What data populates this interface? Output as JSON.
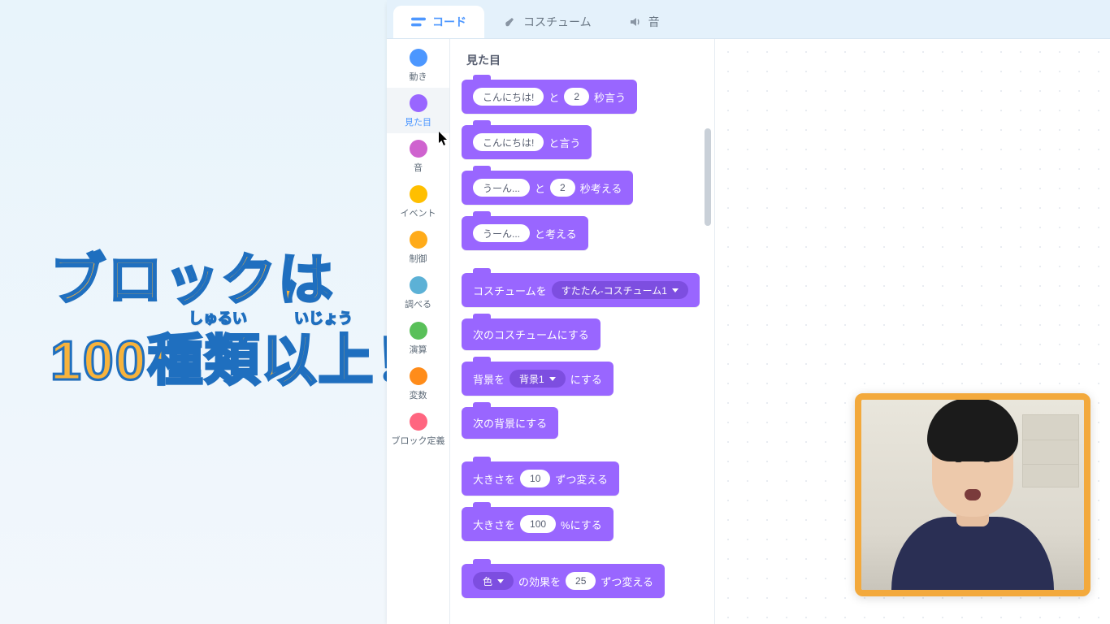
{
  "caption": {
    "line1": "ブロックは",
    "line2": "100種類以上！",
    "ruby1": "しゅるい",
    "ruby2": "いじょう"
  },
  "tabs": {
    "code": "コード",
    "costumes": "コスチューム",
    "sounds": "音"
  },
  "categories": [
    {
      "label": "動き",
      "color": "#4c97ff"
    },
    {
      "label": "見た目",
      "color": "#9966ff"
    },
    {
      "label": "音",
      "color": "#cf63cf"
    },
    {
      "label": "イベント",
      "color": "#ffbf00"
    },
    {
      "label": "制御",
      "color": "#ffab19"
    },
    {
      "label": "調べる",
      "color": "#5cb1d6"
    },
    {
      "label": "演算",
      "color": "#59c059"
    },
    {
      "label": "変数",
      "color": "#ff8c1a"
    },
    {
      "label": "ブロック定義",
      "color": "#ff6680"
    }
  ],
  "palette": {
    "heading": "見た目",
    "blocks": {
      "say_for": {
        "pre": "",
        "msg": "こんにちは!",
        "mid": "と",
        "secs": "2",
        "post": "秒言う"
      },
      "say": {
        "msg": "こんにちは!",
        "post": "と言う"
      },
      "think_for": {
        "msg": "うーん...",
        "mid": "と",
        "secs": "2",
        "post": "秒考える"
      },
      "think": {
        "msg": "うーん...",
        "post": "と考える"
      },
      "switch_costume": {
        "pre": "コスチュームを",
        "menu": "すたたん-コスチューム1"
      },
      "next_costume": {
        "label": "次のコスチュームにする"
      },
      "switch_backdrop": {
        "pre": "背景を",
        "menu": "背景1",
        "post": "にする"
      },
      "next_backdrop": {
        "label": "次の背景にする"
      },
      "change_size": {
        "pre": "大きさを",
        "num": "10",
        "post": "ずつ変える"
      },
      "set_size": {
        "pre": "大きさを",
        "num": "100",
        "post": "%にする"
      },
      "change_effect": {
        "menu": "色",
        "mid": "の効果を",
        "num": "25",
        "post": "ずつ変える"
      }
    }
  }
}
